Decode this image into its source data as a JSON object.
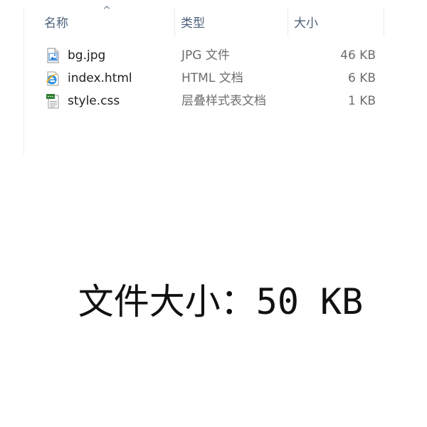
{
  "columns": {
    "name": "名称",
    "type": "类型",
    "size": "大小",
    "sort_indicator": "^"
  },
  "files": [
    {
      "name": "bg.jpg",
      "type": "JPG 文件",
      "size": "46 KB",
      "icon": "jpg-image-file-icon"
    },
    {
      "name": "index.html",
      "type": "HTML 文档",
      "size": "6 KB",
      "icon": "html-document-icon"
    },
    {
      "name": "style.css",
      "type": "层叠样式表文档",
      "size": "1 KB",
      "icon": "css-stylesheet-icon"
    }
  ],
  "caption": "文件大小：50 KB",
  "colors": {
    "header_text": "#4c607a",
    "name_text": "#1e1e1e",
    "detail_text": "#6d6d6d",
    "css_icon_green": "#2f7d32",
    "image_icon_blue": "#2a7fd4"
  }
}
